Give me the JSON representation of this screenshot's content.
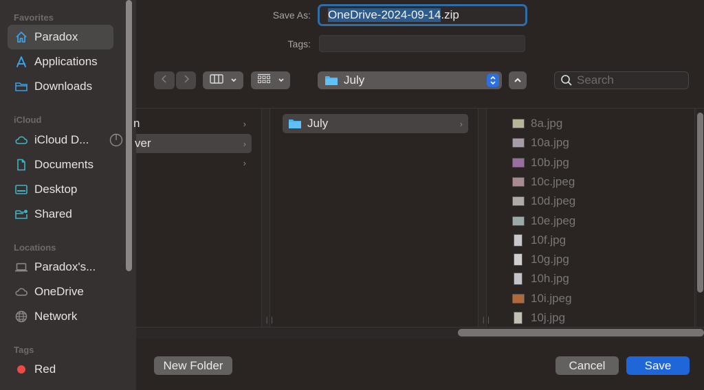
{
  "sidebar": {
    "sections": {
      "favorites": "Favorites",
      "icloud": "iCloud",
      "locations": "Locations",
      "tags": "Tags"
    },
    "favorites": [
      {
        "label": "Paradox",
        "icon": "home-icon",
        "selected": true
      },
      {
        "label": "Applications",
        "icon": "applications-icon"
      },
      {
        "label": "Downloads",
        "icon": "downloads-folder-icon"
      }
    ],
    "icloud": [
      {
        "label": "iCloud D...",
        "icon": "icloud-icon"
      },
      {
        "label": "Documents",
        "icon": "document-icon"
      },
      {
        "label": "Desktop",
        "icon": "desktop-icon"
      },
      {
        "label": "Shared",
        "icon": "shared-folder-icon"
      }
    ],
    "locations": [
      {
        "label": "Paradox's...",
        "icon": "laptop-icon"
      },
      {
        "label": "OneDrive",
        "icon": "cloud-icon"
      },
      {
        "label": "Network",
        "icon": "globe-icon"
      }
    ],
    "tags": [
      {
        "label": "Red",
        "color": "#ec4a44"
      }
    ]
  },
  "form": {
    "save_as_label": "Save As:",
    "save_as_selected": "OneDrive-2024-09-14",
    "save_as_ext": ".zip",
    "tags_label": "Tags:",
    "tags_value": ""
  },
  "toolbar": {
    "location": "July",
    "search_placeholder": "Search"
  },
  "browser": {
    "col1": [
      {
        "label": "n",
        "selected": false
      },
      {
        "label": "ver",
        "selected": true
      },
      {
        "label": "",
        "selected": false
      }
    ],
    "col2": [
      {
        "label": "July",
        "selected": true
      }
    ],
    "files": [
      {
        "name": "8a.jpg",
        "thumb": "#b8b49a"
      },
      {
        "name": "10a.jpg",
        "thumb": "#a89aa6"
      },
      {
        "name": "10b.jpg",
        "thumb": "#9a6fa0"
      },
      {
        "name": "10c.jpeg",
        "thumb": "#a88a90"
      },
      {
        "name": "10d.jpeg",
        "thumb": "#b0aba6"
      },
      {
        "name": "10e.jpeg",
        "thumb": "#9aaaa8"
      },
      {
        "name": "10f.jpg",
        "thumb": "#c8c8cc",
        "tall": true
      },
      {
        "name": "10g.jpg",
        "thumb": "#cfcfd2",
        "tall": true
      },
      {
        "name": "10h.jpg",
        "thumb": "#c4c4c8",
        "tall": true
      },
      {
        "name": "10i.jpeg",
        "thumb": "#b06a3a"
      },
      {
        "name": "10j.jpg",
        "thumb": "#c0c0b4",
        "tall": true
      }
    ]
  },
  "buttons": {
    "new_folder": "New Folder",
    "cancel": "Cancel",
    "save": "Save"
  },
  "colors": {
    "accent": "#1f66d9",
    "focus_ring": "#2f6ca8",
    "icon_blue": "#3aa0e8",
    "icon_teal": "#3bb6c4"
  }
}
